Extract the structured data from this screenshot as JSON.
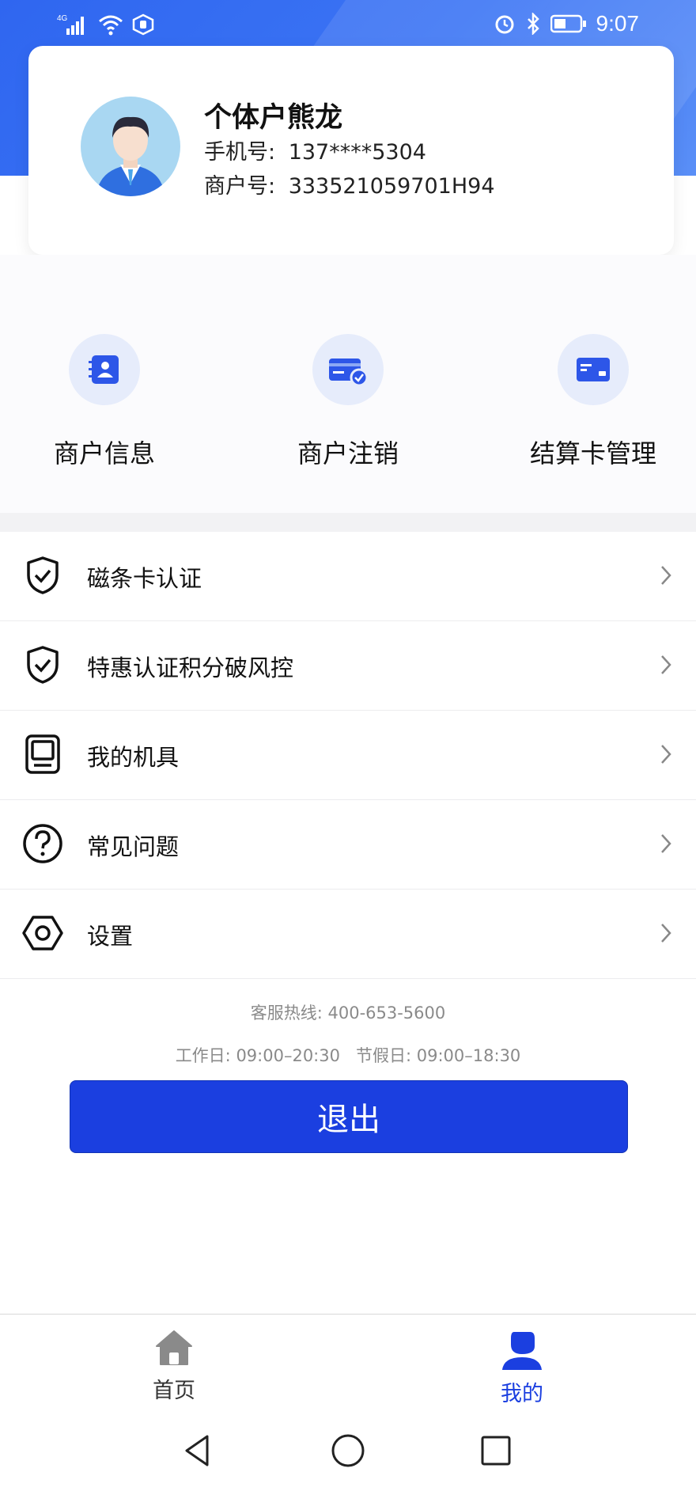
{
  "status_bar": {
    "network": "4G",
    "time": "9:07"
  },
  "profile": {
    "name": "个体户熊龙",
    "phone_label": "手机号:",
    "phone_value": "137****5304",
    "merchant_label": "商户号:",
    "merchant_value": "333521059701H94"
  },
  "quick_actions": [
    {
      "label": "商户信息",
      "icon": "contact-card-icon"
    },
    {
      "label": "商户注销",
      "icon": "card-check-icon"
    },
    {
      "label": "结算卡管理",
      "icon": "bank-card-icon"
    }
  ],
  "menu": [
    {
      "label": "磁条卡认证",
      "icon": "shield-check-icon"
    },
    {
      "label": "特惠认证积分破风控",
      "icon": "shield-check-icon"
    },
    {
      "label": "我的机具",
      "icon": "pos-terminal-icon"
    },
    {
      "label": "常见问题",
      "icon": "question-circle-icon"
    },
    {
      "label": "设置",
      "icon": "hexagon-settings-icon"
    }
  ],
  "support": {
    "hotline": "客服热线: 400-653-5600",
    "hours": "工作日: 09:00–20:30   节假日: 09:00–18:30"
  },
  "logout_label": "退出",
  "tabs": [
    {
      "label": "首页",
      "icon": "home-icon",
      "active": false
    },
    {
      "label": "我的",
      "icon": "user-icon",
      "active": true
    }
  ],
  "colors": {
    "primary": "#1b3fe0",
    "header": "#3b74f4",
    "icon_bg": "#e6ecfb"
  }
}
